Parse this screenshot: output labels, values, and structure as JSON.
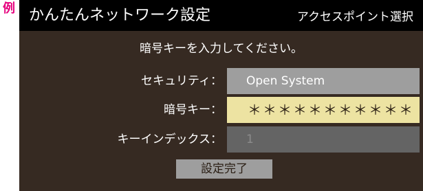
{
  "example_mark": "例",
  "header": {
    "title": "かんたんネットワーク設定",
    "subtitle": "アクセスポイント選択"
  },
  "instruction": "暗号キーを入力してください。",
  "form": {
    "security": {
      "label": "セキュリティ：",
      "value": "Open System"
    },
    "encryption_key": {
      "label": "暗号キー：",
      "value": "＊＊＊＊＊＊＊＊＊＊＊"
    },
    "key_index": {
      "label": "キーインデックス：",
      "value": "1"
    }
  },
  "buttons": {
    "complete": "設定完了"
  },
  "colors": {
    "background": "#362a22",
    "titlebar": "#000000",
    "field_gray": "#9e9e9e",
    "field_focused": "#ede3a2",
    "field_disabled": "#646464",
    "example_mark": "#e6007e"
  }
}
